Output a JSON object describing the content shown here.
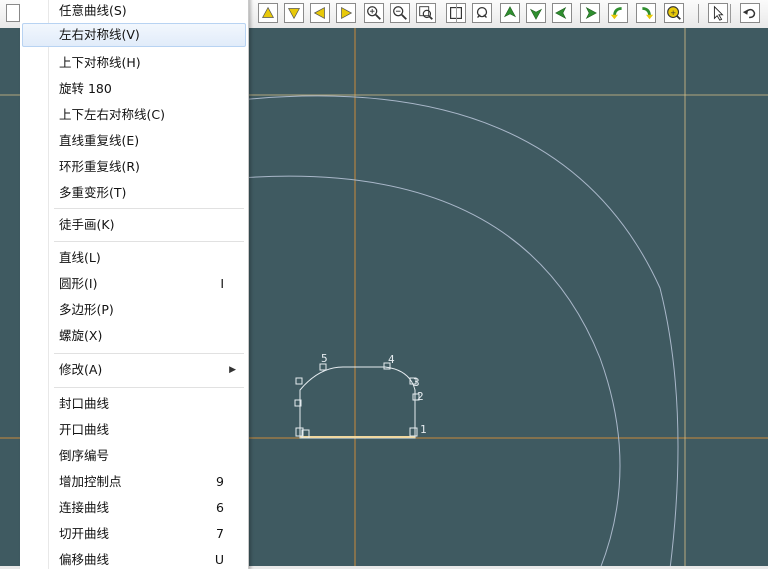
{
  "colors": {
    "canvas_bg": "#3f5a61",
    "axis": "#c8893a",
    "guide": "#d9c087",
    "arc": "#a9b7c9",
    "curve": "#e6ecf0",
    "toolbar_icon": "#e8c90a",
    "menu_highlight": "#e1ecfa"
  },
  "toolbar": {
    "icons": [
      "triangle-up-icon",
      "triangle-down-icon",
      "triangle-left-icon",
      "triangle-right-icon",
      "zoom-in-icon",
      "zoom-out-icon",
      "zoom-window-icon",
      "square-icon",
      "pan-icon",
      "arrow-up-icon",
      "arrow-down-icon",
      "arrow-left-icon",
      "arrow-right-icon",
      "rotate-left-icon",
      "rotate-right-icon",
      "zoom-all-icon",
      "select-pointer-icon",
      "undo-icon"
    ]
  },
  "menu": {
    "items": [
      {
        "label": "任意曲线(S)",
        "shortcut": ""
      },
      {
        "label": "左右对称线(V)",
        "shortcut": "",
        "highlighted": true
      },
      {
        "label": "上下对称线(H)",
        "shortcut": ""
      },
      {
        "label": "旋转 180",
        "shortcut": ""
      },
      {
        "label": "上下左右对称线(C)",
        "shortcut": ""
      },
      {
        "label": "直线重复线(E)",
        "shortcut": ""
      },
      {
        "label": "环形重复线(R)",
        "shortcut": ""
      },
      {
        "label": "多重变形(T)",
        "shortcut": ""
      },
      {
        "label": "徒手画(K)",
        "shortcut": ""
      },
      {
        "label": "直线(L)",
        "shortcut": ""
      },
      {
        "label": "圆形(I)",
        "shortcut": "I"
      },
      {
        "label": "多边形(P)",
        "shortcut": ""
      },
      {
        "label": "螺旋(X)",
        "shortcut": ""
      },
      {
        "label": "修改(A)",
        "shortcut": "",
        "submenu": true
      },
      {
        "label": "封口曲线",
        "shortcut": ""
      },
      {
        "label": "开口曲线",
        "shortcut": ""
      },
      {
        "label": "倒序编号",
        "shortcut": ""
      },
      {
        "label": "增加控制点",
        "shortcut": "9"
      },
      {
        "label": "连接曲线",
        "shortcut": "6"
      },
      {
        "label": "切开曲线",
        "shortcut": "7"
      },
      {
        "label": "偏移曲线",
        "shortcut": "U"
      }
    ]
  },
  "canvas": {
    "point_labels": [
      "1",
      "2",
      "3",
      "4",
      "5"
    ]
  }
}
